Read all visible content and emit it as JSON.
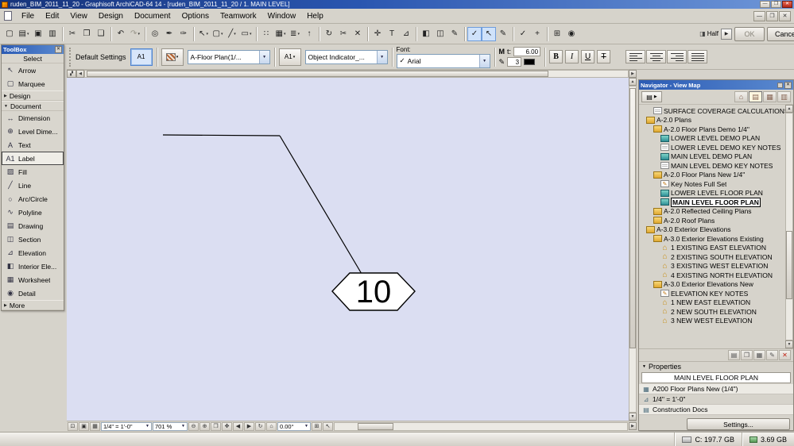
{
  "titlebar": {
    "title": "ruden_BIM_2011_11_20 - Graphisoft ArchiCAD-64 14 - [ruden_BIM_2011_11_20 / 1. MAIN LEVEL]"
  },
  "menubar": {
    "items": [
      "File",
      "Edit",
      "View",
      "Design",
      "Document",
      "Options",
      "Teamwork",
      "Window",
      "Help"
    ]
  },
  "toolbar": {
    "half_label": "Half",
    "ok_label": "OK",
    "cancel_label": "Cancel",
    "buttons": [
      {
        "name": "new-document",
        "glyph": "▢"
      },
      {
        "name": "open-file",
        "glyph": "▤",
        "dd": true
      },
      {
        "name": "save",
        "glyph": "▣"
      },
      {
        "name": "print",
        "glyph": "▥"
      },
      {
        "sep": true
      },
      {
        "name": "cut",
        "glyph": "✂"
      },
      {
        "name": "copy",
        "glyph": "❐"
      },
      {
        "name": "paste",
        "glyph": "❑"
      },
      {
        "sep": true
      },
      {
        "name": "undo",
        "glyph": "↶"
      },
      {
        "name": "redo",
        "glyph": "↷",
        "dd": true,
        "disabled": true
      },
      {
        "sep": true
      },
      {
        "name": "find-select",
        "glyph": "◎"
      },
      {
        "name": "pick-up-parameters",
        "glyph": "✒"
      },
      {
        "name": "inject-parameters",
        "glyph": "✑"
      },
      {
        "sep": true
      },
      {
        "name": "arrow-tool",
        "glyph": "↖",
        "dd": true
      },
      {
        "name": "marquee-tool",
        "glyph": "▢",
        "dd": true
      },
      {
        "name": "line-tools",
        "glyph": "╱",
        "dd": true
      },
      {
        "name": "polygon-tools",
        "glyph": "▭",
        "dd": true
      },
      {
        "sep": true
      },
      {
        "name": "snap-points",
        "glyph": "∷"
      },
      {
        "name": "element-schedule",
        "glyph": "▦",
        "dd": true
      },
      {
        "name": "layer-settings",
        "glyph": "≣",
        "dd": true
      },
      {
        "name": "bring-forward",
        "glyph": "↑"
      },
      {
        "sep": true
      },
      {
        "name": "rotate",
        "glyph": "↻"
      },
      {
        "name": "split",
        "glyph": "✂"
      },
      {
        "name": "delete-element",
        "glyph": "✕"
      },
      {
        "sep": true
      },
      {
        "name": "drag",
        "glyph": "✛"
      },
      {
        "name": "text-edit",
        "glyph": "T"
      },
      {
        "name": "measure",
        "glyph": "⊿"
      },
      {
        "sep": true
      },
      {
        "name": "show-toolbox-panel",
        "glyph": "◧"
      },
      {
        "name": "show-infobox-panel",
        "glyph": "◫"
      },
      {
        "name": "markup-pen",
        "glyph": "✎"
      },
      {
        "sep": true
      },
      {
        "name": "suspend-groups",
        "glyph": "✓",
        "selected": true
      },
      {
        "name": "select-arrow-mode",
        "glyph": "↖",
        "selected": true
      },
      {
        "name": "edit-pencil-mode",
        "glyph": "✎"
      },
      {
        "sep": true
      },
      {
        "name": "confirm",
        "glyph": "✓"
      },
      {
        "name": "add-element",
        "glyph": "+"
      },
      {
        "sep": true
      },
      {
        "name": "grid-snap",
        "glyph": "⊞"
      },
      {
        "name": "zoom-options",
        "glyph": "◉"
      }
    ]
  },
  "infobox": {
    "default_settings_label": "Default Settings",
    "label_tool_glyph": "A1",
    "layer_value": "A-Floor Plan(1/...",
    "label_type_glyph": "A1",
    "object_value": "Object Indicator_...",
    "font_label": "Font:",
    "font_check": "✓",
    "font_value": "Arial",
    "size_icon_glyph": "M",
    "size_label": "t:",
    "size_value": "6.00",
    "pen_icon_glyph": "✎",
    "pen_value": "3",
    "style_buttons": [
      {
        "name": "bold",
        "label": "B"
      },
      {
        "name": "italic",
        "label": "I"
      },
      {
        "name": "underline",
        "label": "U"
      },
      {
        "name": "strikethrough",
        "label": "T"
      }
    ]
  },
  "toolbox": {
    "title": "ToolBox",
    "items": [
      {
        "type": "section",
        "label": "Select"
      },
      {
        "type": "item",
        "name": "arrow",
        "label": "Arrow",
        "glyph": "↖"
      },
      {
        "type": "item",
        "name": "marquee",
        "label": "Marquee",
        "glyph": "▢"
      },
      {
        "type": "group",
        "label": "Design",
        "collapsed": true
      },
      {
        "type": "group",
        "label": "Document",
        "collapsed": false
      },
      {
        "type": "item",
        "name": "dimension",
        "label": "Dimension",
        "glyph": "↔"
      },
      {
        "type": "item",
        "name": "level-dimension",
        "label": "Level Dime...",
        "glyph": "⊕"
      },
      {
        "type": "item",
        "name": "text",
        "label": "Text",
        "glyph": "A"
      },
      {
        "type": "item",
        "name": "label",
        "label": "Label",
        "glyph": "A1",
        "selected": true
      },
      {
        "type": "item",
        "name": "fill",
        "label": "Fill",
        "glyph": "▨"
      },
      {
        "type": "item",
        "name": "line",
        "label": "Line",
        "glyph": "╱"
      },
      {
        "type": "item",
        "name": "arc-circle",
        "label": "Arc/Circle",
        "glyph": "○"
      },
      {
        "type": "item",
        "name": "polyline",
        "label": "Polyline",
        "glyph": "∿"
      },
      {
        "type": "item",
        "name": "drawing",
        "label": "Drawing",
        "glyph": "▤"
      },
      {
        "type": "item",
        "name": "section",
        "label": "Section",
        "glyph": "◫"
      },
      {
        "type": "item",
        "name": "elevation",
        "label": "Elevation",
        "glyph": "⊿"
      },
      {
        "type": "item",
        "name": "interior-elevation",
        "label": "Interior Ele...",
        "glyph": "◧"
      },
      {
        "type": "item",
        "name": "worksheet",
        "label": "Worksheet",
        "glyph": "▦"
      },
      {
        "type": "item",
        "name": "detail",
        "label": "Detail",
        "glyph": "◉"
      },
      {
        "type": "group",
        "label": "More",
        "collapsed": true
      }
    ]
  },
  "canvas": {
    "label_text": "10"
  },
  "canvas_bar": {
    "left_buttons": [
      {
        "name": "quick-options",
        "glyph": "⊡"
      },
      {
        "name": "pen-sets",
        "glyph": "▣"
      },
      {
        "name": "favorites",
        "glyph": "▦"
      }
    ],
    "scale_value": "1/4\"  =  1'-0\"",
    "zoom_value": "701 %",
    "zoom_buttons": [
      {
        "name": "zoom-out",
        "glyph": "⊖"
      },
      {
        "name": "zoom-in",
        "glyph": "⊕"
      },
      {
        "name": "fit-in-window",
        "glyph": "❐"
      },
      {
        "name": "pan",
        "glyph": "✥"
      },
      {
        "name": "previous-zoom",
        "glyph": "◀"
      },
      {
        "name": "next-zoom",
        "glyph": "▶"
      },
      {
        "name": "rotate-view",
        "glyph": "↻"
      },
      {
        "name": "home-view",
        "glyph": "⌂"
      }
    ],
    "angle_value": "0.00°",
    "right_buttons": [
      {
        "name": "better-preview",
        "glyph": "⊞"
      },
      {
        "name": "arrow-mode",
        "glyph": "↖"
      }
    ]
  },
  "navigator": {
    "title": "Navigator - View Map",
    "tabs": [
      {
        "name": "project-map",
        "glyph": "⌂"
      },
      {
        "name": "view-map",
        "glyph": "▤",
        "selected": true
      },
      {
        "name": "layout-book",
        "glyph": "▦"
      },
      {
        "name": "publisher",
        "glyph": "▥"
      }
    ],
    "tree": [
      {
        "label": "SURFACE COVERAGE CALCULATIONS",
        "level": 3,
        "icon": "worksheet"
      },
      {
        "label": "A-2.0 Plans",
        "level": 2,
        "icon": "folder"
      },
      {
        "label": "A-2.0 Floor Plans Demo 1/4\"",
        "level": 3,
        "icon": "folder"
      },
      {
        "label": "LOWER LEVEL DEMO PLAN",
        "level": 4,
        "icon": "plan"
      },
      {
        "label": "LOWER LEVEL DEMO KEY NOTES",
        "level": 4,
        "icon": "worksheet"
      },
      {
        "label": "MAIN LEVEL DEMO PLAN",
        "level": 4,
        "icon": "plan"
      },
      {
        "label": "MAIN LEVEL DEMO KEY NOTES",
        "level": 4,
        "icon": "worksheet"
      },
      {
        "label": "A-2.0 Floor Plans New 1/4\"",
        "level": 3,
        "icon": "folder"
      },
      {
        "label": "Key Notes Full Set",
        "level": 4,
        "icon": "keynote"
      },
      {
        "label": "LOWER LEVEL FLOOR PLAN",
        "level": 4,
        "icon": "plan"
      },
      {
        "label": "MAIN LEVEL FLOOR PLAN",
        "level": 4,
        "icon": "plan",
        "selected": true
      },
      {
        "label": "A-2.0 Reflected Ceiling Plans",
        "level": 3,
        "icon": "folder"
      },
      {
        "label": "A-2.0 Roof Plans",
        "level": 3,
        "icon": "folder"
      },
      {
        "label": "A-3.0 Exterior Elevations",
        "level": 2,
        "icon": "folder"
      },
      {
        "label": "A-3.0 Exterior Elevations Existing",
        "level": 3,
        "icon": "folder"
      },
      {
        "label": "1 EXISTING EAST ELEVATION",
        "level": 4,
        "icon": "elevation"
      },
      {
        "label": "2 EXISTING SOUTH ELEVATION",
        "level": 4,
        "icon": "elevation"
      },
      {
        "label": "3 EXISTING WEST ELEVATION",
        "level": 4,
        "icon": "elevation"
      },
      {
        "label": "4 EXISTING NORTH ELEVATION",
        "level": 4,
        "icon": "elevation"
      },
      {
        "label": "A-3.0 Exterior Elevations New",
        "level": 3,
        "icon": "folder"
      },
      {
        "label": "ELEVATION KEY NOTES",
        "level": 4,
        "icon": "keynote"
      },
      {
        "label": "1 NEW EAST ELEVATION",
        "level": 4,
        "icon": "elevation"
      },
      {
        "label": "2 NEW SOUTH ELEVATION",
        "level": 4,
        "icon": "elevation"
      },
      {
        "label": "3 NEW WEST ELEVATION",
        "level": 4,
        "icon": "elevation"
      }
    ],
    "actions": [
      {
        "name": "new-folder",
        "glyph": "▤"
      },
      {
        "name": "clone-folder",
        "glyph": "❐"
      },
      {
        "name": "save-current-view",
        "glyph": "▦"
      },
      {
        "name": "view-settings",
        "glyph": "✎"
      },
      {
        "name": "delete-view",
        "glyph": "✕",
        "danger": true
      }
    ],
    "properties": {
      "header": "Properties",
      "name_value": "MAIN LEVEL FLOOR PLAN",
      "rows": [
        {
          "name": "layout",
          "glyph": "▦",
          "label": "A200 Floor Plans New (1/4\")"
        },
        {
          "name": "scale",
          "glyph": "⊿",
          "label": "1/4\"  =  1'-0\""
        },
        {
          "name": "subset",
          "glyph": "▤",
          "label": "Construction Docs"
        }
      ],
      "settings_label": "Settings..."
    }
  },
  "statusbar": {
    "disk": "C: 197.7 GB",
    "memory": "3.69 GB"
  }
}
